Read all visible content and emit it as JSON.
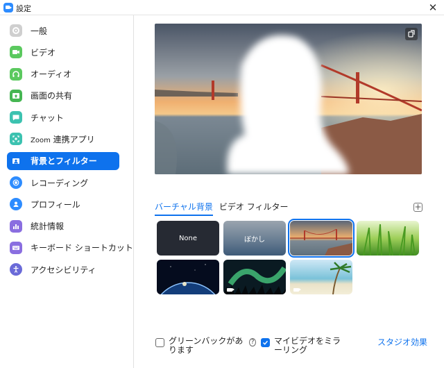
{
  "window": {
    "title": "設定",
    "close_glyph": "✕"
  },
  "sidebar": {
    "items": [
      {
        "label": "一般",
        "icon": "gear-icon",
        "color": "#cfcfcf"
      },
      {
        "label": "ビデオ",
        "icon": "video-icon",
        "color": "#5bc95f"
      },
      {
        "label": "オーディオ",
        "icon": "headphones-icon",
        "color": "#5bc95f"
      },
      {
        "label": "画面の共有",
        "icon": "share-screen-icon",
        "color": "#45b652"
      },
      {
        "label": "チャット",
        "icon": "chat-icon",
        "color": "#3cc2b0"
      },
      {
        "label_small": "Zoom",
        "label": "連携アプリ",
        "icon": "apps-icon",
        "color": "#3cc2b0"
      },
      {
        "label": "背景とフィルター",
        "icon": "background-icon",
        "color": "#0e72ed",
        "active": true
      },
      {
        "label": "レコーディング",
        "icon": "record-icon",
        "color": "#2d8cff"
      },
      {
        "label": "プロフィール",
        "icon": "profile-icon",
        "color": "#2d8cff"
      },
      {
        "label": "統計情報",
        "icon": "statistics-icon",
        "color": "#8a6ee0"
      },
      {
        "label": "キーボード ショートカット",
        "icon": "keyboard-icon",
        "color": "#8a6ee0"
      },
      {
        "label": "アクセシビリティ",
        "icon": "accessibility-icon",
        "color": "#6a6ad8"
      }
    ]
  },
  "main": {
    "tabs": [
      {
        "label": "バーチャル背景",
        "active": true
      },
      {
        "label": "ビデオ フィルター",
        "active": false
      }
    ],
    "add_glyph": "+",
    "tiles": [
      {
        "label": "None",
        "kind": "none"
      },
      {
        "label": "ぼかし",
        "kind": "blur"
      },
      {
        "label": "",
        "kind": "golden-gate",
        "selected": true
      },
      {
        "label": "",
        "kind": "grass"
      },
      {
        "label": "",
        "kind": "earth"
      },
      {
        "label": "",
        "kind": "aurora",
        "video": true
      },
      {
        "label": "",
        "kind": "beach",
        "video": true
      }
    ],
    "options": {
      "green_screen_label": "グリーンバックがあります",
      "help_glyph": "?",
      "green_screen_checked": false,
      "mirror_label": "マイビデオをミラーリング",
      "mirror_checked": true
    },
    "studio_effects_label": "スタジオ効果"
  },
  "colors": {
    "accent": "#0e72ed"
  }
}
